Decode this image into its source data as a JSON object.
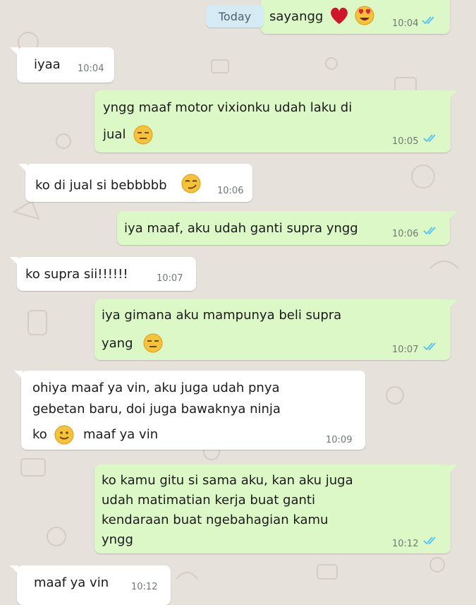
{
  "date_separator": "Today",
  "messages": [
    {
      "side": "out",
      "text": "sayangg",
      "time": "10:04"
    },
    {
      "side": "in",
      "text": "iyaa",
      "time": "10:04"
    },
    {
      "side": "out",
      "lines": [
        "yngg maaf motor vixionku udah laku di",
        "jual"
      ],
      "time": "10:05"
    },
    {
      "side": "in",
      "text": "ko di jual si bebbbbb",
      "time": "10:06"
    },
    {
      "side": "out",
      "text": "iya maaf, aku udah ganti supra yngg",
      "time": "10:06"
    },
    {
      "side": "in",
      "text": "ko supra sii!!!!!!",
      "time": "10:07"
    },
    {
      "side": "out",
      "lines": [
        "iya gimana aku mampunya beli supra",
        "yang"
      ],
      "time": "10:07"
    },
    {
      "side": "in",
      "lines": [
        "ohiya maaf ya vin, aku juga udah pnya",
        "gebetan baru, doi juga bawaknya ninja",
        "ko",
        "maaf ya vin"
      ],
      "time": "10:09"
    },
    {
      "side": "out",
      "lines": [
        "ko kamu gitu si sama aku, kan aku juga",
        "udah matimatian kerja buat ganti",
        "kendaraan buat ngebahagian kamu",
        "yngg"
      ],
      "time": "10:12"
    },
    {
      "side": "in",
      "text": "maaf ya vin",
      "time": "10:12"
    }
  ],
  "colors": {
    "incoming": "#ffffff",
    "outgoing": "#dcf8c6",
    "read_ticks": "#4fc3f7",
    "background": "#e6e1da"
  },
  "icons": [
    "double-check-icon",
    "heart-emoji-icon",
    "heart-eyes-emoji-icon",
    "expressionless-emoji-icon",
    "smirk-emoji-icon",
    "smiley-emoji-icon"
  ]
}
